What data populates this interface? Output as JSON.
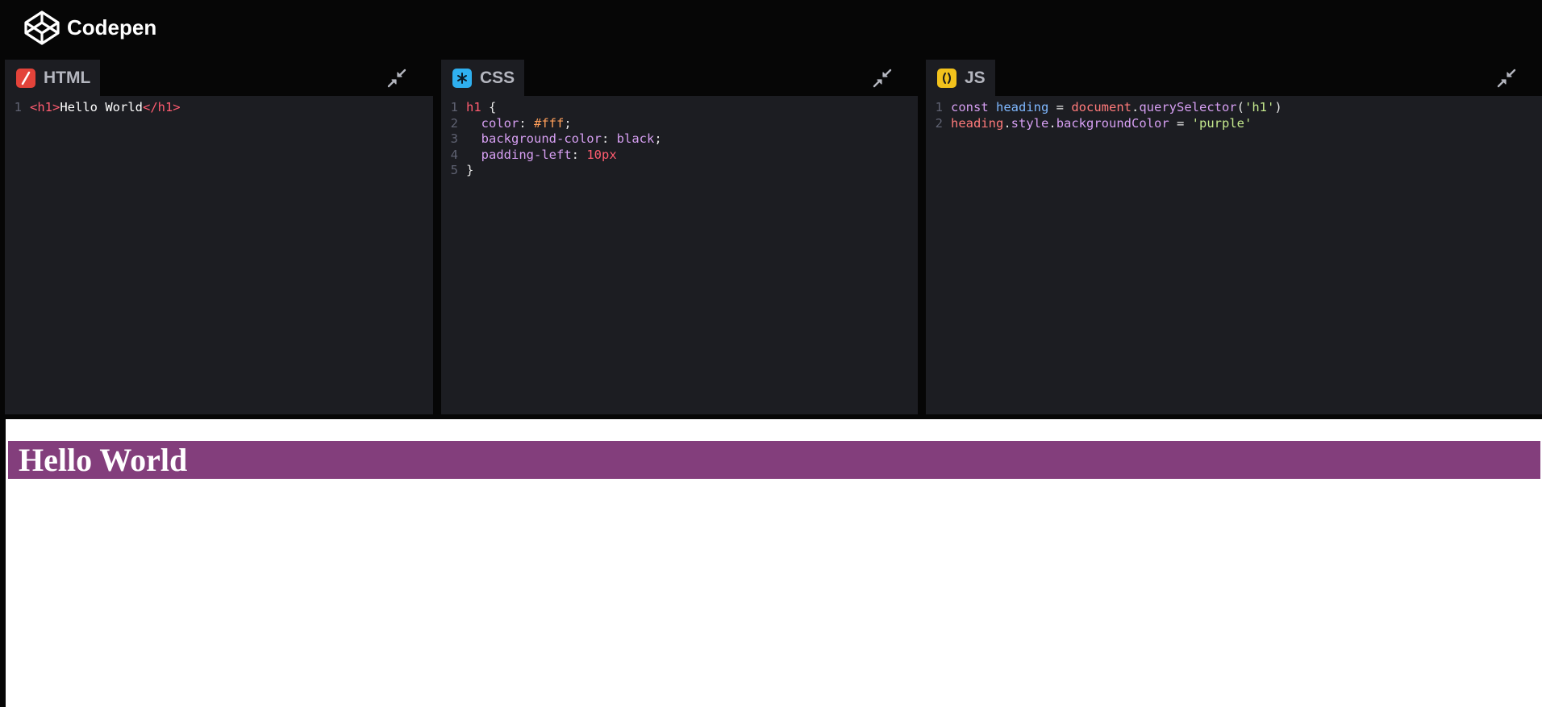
{
  "app": {
    "name": "Codepen",
    "logo_icon": "codepen-cube-icon"
  },
  "colors": {
    "html_badge": "#e3433a",
    "css_badge": "#2fb0f0",
    "js_badge": "#f2c21c",
    "editor_bg": "#1c1d22",
    "preview_heading_bg": "#833e7c"
  },
  "panels": {
    "html": {
      "label": "HTML",
      "badge_glyph": "/",
      "lines": [
        {
          "n": "1",
          "tokens": [
            {
              "t": "<h1>",
              "c": "t-tag"
            },
            {
              "t": "Hello World",
              "c": "t-text"
            },
            {
              "t": "</h1>",
              "c": "t-tag"
            }
          ]
        }
      ]
    },
    "css": {
      "label": "CSS",
      "badge_glyph": "*",
      "lines": [
        {
          "n": "1",
          "tokens": [
            {
              "t": "h1",
              "c": "t-sel"
            },
            {
              "t": " {",
              "c": "t-punct"
            }
          ]
        },
        {
          "n": "2",
          "tokens": [
            {
              "t": "  color",
              "c": "t-prop"
            },
            {
              "t": ": ",
              "c": "t-punct"
            },
            {
              "t": "#fff",
              "c": "t-colorval"
            },
            {
              "t": ";",
              "c": "t-punct"
            }
          ]
        },
        {
          "n": "3",
          "tokens": [
            {
              "t": "  background-color",
              "c": "t-prop"
            },
            {
              "t": ": ",
              "c": "t-punct"
            },
            {
              "t": "black",
              "c": "t-kw"
            },
            {
              "t": ";",
              "c": "t-punct"
            }
          ]
        },
        {
          "n": "4",
          "tokens": [
            {
              "t": "  padding-left",
              "c": "t-prop"
            },
            {
              "t": ": ",
              "c": "t-punct"
            },
            {
              "t": "10px",
              "c": "t-num"
            }
          ]
        },
        {
          "n": "5",
          "tokens": [
            {
              "t": "}",
              "c": "t-punct"
            }
          ]
        }
      ]
    },
    "js": {
      "label": "JS",
      "badge_glyph": "()",
      "lines": [
        {
          "n": "1",
          "tokens": [
            {
              "t": "const ",
              "c": "t-kw"
            },
            {
              "t": "heading",
              "c": "t-var"
            },
            {
              "t": " = ",
              "c": "t-punct"
            },
            {
              "t": "document",
              "c": "t-obj"
            },
            {
              "t": ".",
              "c": "t-punct"
            },
            {
              "t": "querySelector",
              "c": "t-kw"
            },
            {
              "t": "(",
              "c": "t-punct"
            },
            {
              "t": "'h1'",
              "c": "t-str"
            },
            {
              "t": ")",
              "c": "t-punct"
            }
          ]
        },
        {
          "n": "2",
          "tokens": [
            {
              "t": "heading",
              "c": "t-obj"
            },
            {
              "t": ".",
              "c": "t-punct"
            },
            {
              "t": "style",
              "c": "t-kw"
            },
            {
              "t": ".",
              "c": "t-punct"
            },
            {
              "t": "backgroundColor",
              "c": "t-kw"
            },
            {
              "t": " = ",
              "c": "t-punct"
            },
            {
              "t": "'purple'",
              "c": "t-str"
            }
          ]
        }
      ]
    }
  },
  "preview": {
    "heading": "Hello World"
  }
}
